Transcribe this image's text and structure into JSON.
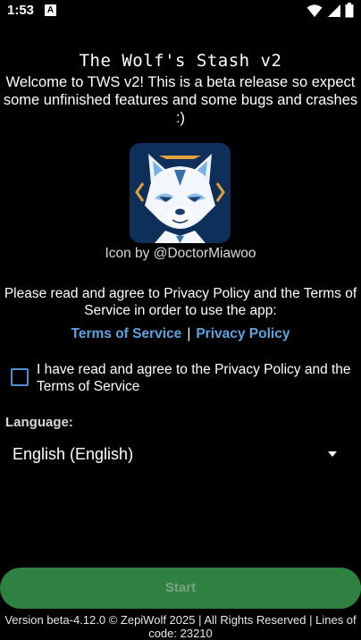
{
  "status_bar": {
    "time": "1:53",
    "notification_icon": "A",
    "icons": [
      "wifi-icon",
      "signal-icon",
      "battery-icon"
    ]
  },
  "header": {
    "title": "The Wolf's Stash v2",
    "welcome": "Welcome to TWS v2! This is a beta release so expect some unfinished features and some bugs and crashes :)"
  },
  "icon": {
    "name": "wolf-logo-icon",
    "credit": "Icon by @DoctorMiawoo",
    "background_color": "#0f2f5b"
  },
  "agreement": {
    "prompt": "Please read and agree to Privacy Policy and the Terms of Service in order to use the app:",
    "terms_link": "Terms of Service",
    "separator": "|",
    "privacy_link": "Privacy Policy",
    "checkbox_label": "I have read and agree to the Privacy Policy and the Terms of Service",
    "checked": false
  },
  "language": {
    "label": "Language:",
    "selected": "English (English)"
  },
  "start_button": {
    "label": "Start",
    "enabled": false
  },
  "footer": {
    "text": "Version beta-4.12.0 © ZepiWolf 2025 | All Rights Reserved | Lines of code: 23210"
  },
  "colors": {
    "background": "#000000",
    "link": "#5ea3e0",
    "button": "#2f8141",
    "checkbox_border": "#4f8fd0"
  }
}
